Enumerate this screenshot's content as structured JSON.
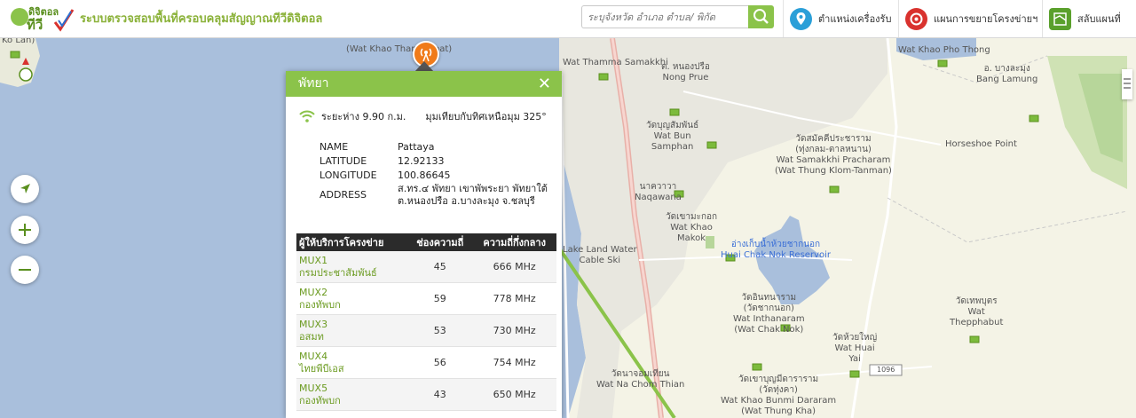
{
  "header": {
    "logo_text": "ระบบตรวจสอบพื้นที่ครอบคลุมสัญญาณทีวีดิจิตอล",
    "search_placeholder": "ระบุจังหวัด อำเภอ ตำบล/ พิกัด",
    "nav": [
      {
        "label": "ตำแหน่งเครื่องรับ",
        "icon": "map-pin-icon",
        "color": "#2a9fd8"
      },
      {
        "label": "แผนการขยายโครงข่ายฯ",
        "icon": "network-plan-icon",
        "color": "#d9322e"
      },
      {
        "label": "สลับแผนที่",
        "icon": "map-switch-icon",
        "color": "#5aa02c"
      }
    ]
  },
  "popup": {
    "title": "พัทยา",
    "distance": "ระยะห่าง 9.90 ก.ม.",
    "bearing": "มุมเทียบกับทิศเหนือมุม 325°",
    "info": [
      {
        "key": "NAME",
        "value": "Pattaya"
      },
      {
        "key": "LATITUDE",
        "value": "12.92133"
      },
      {
        "key": "LONGITUDE",
        "value": "100.86645"
      },
      {
        "key": "ADDRESS",
        "value": "ส.ทร.๔ พัทยา เขาพัพระยา พัทยาใต้ ต.หนองปรือ อ.บางละมุง จ.ชลบุรี"
      }
    ],
    "table_headers": [
      "ผู้ให้บริการโครงข่าย",
      "ช่องความถี่",
      "ความถี่กึ่งกลาง"
    ],
    "rows": [
      {
        "mux": "MUX1",
        "operator": "กรมประชาสัมพันธ์",
        "channel": "45",
        "freq": "666 MHz"
      },
      {
        "mux": "MUX2",
        "operator": "กองทัพบก",
        "channel": "59",
        "freq": "778 MHz"
      },
      {
        "mux": "MUX3",
        "operator": "อสมท",
        "channel": "53",
        "freq": "730 MHz"
      },
      {
        "mux": "MUX4",
        "operator": "ไทยพีบีเอส",
        "channel": "56",
        "freq": "754 MHz"
      },
      {
        "mux": "MUX5",
        "operator": "กองทัพบก",
        "channel": "43",
        "freq": "650 MHz"
      }
    ]
  },
  "map_labels": [
    {
      "text": "Ko Lan)"
    },
    {
      "text": "(Wat Khao Thammabat)"
    },
    {
      "text": "Wat Thamma Samakkhi"
    },
    {
      "text": "ต. หนองปรือ\nNong Prue"
    },
    {
      "text": "วัดบุญสัมพันธ์\nWat Bun\nSamphan"
    },
    {
      "text": "วัดสมัคคีประชาราม\n(ทุ่งกลม-ตาลหนาน)\nWat Samakkhi Pracharam\n(Wat Thung Klom-Tanman)"
    },
    {
      "text": "Wat Khao Pho Thong"
    },
    {
      "text": "อ. บางละมุง\nBang Lamung"
    },
    {
      "text": "Horseshoe Point"
    },
    {
      "text": "นาควาวา\nNaqawana"
    },
    {
      "text": "วัดเขามะกอก\nWat Khao\nMakok"
    },
    {
      "text": "อ่างเก็บน้ำห้วยชากนอก\nHuai Chak Nok Reservoir"
    },
    {
      "text": "วัดอินทนาราม\n(วัดชากนอก)\nWat Inthanaram\n(Wat Chak Nok)"
    },
    {
      "text": "วัดห้วยใหญ่\nWat Huai\nYai"
    },
    {
      "text": "วัดเทพบุตร\nWat\nThepphabut"
    },
    {
      "text": "วัดนาจอมเทียน\nWat Na Chom Thian"
    },
    {
      "text": "วัดเขาบุญมีดาราราม\n(วัดทุ่งคา)\nWat Khao Bunmi Dararam\n(Wat Thung Kha)"
    },
    {
      "text": "Lake Land Water\nCable Ski"
    },
    {
      "text": "1096"
    }
  ],
  "colors": {
    "accent": "#8bc34a",
    "sea": "#a9bfdc",
    "land": "#f4f3e6",
    "tower": "#f07b1a"
  }
}
